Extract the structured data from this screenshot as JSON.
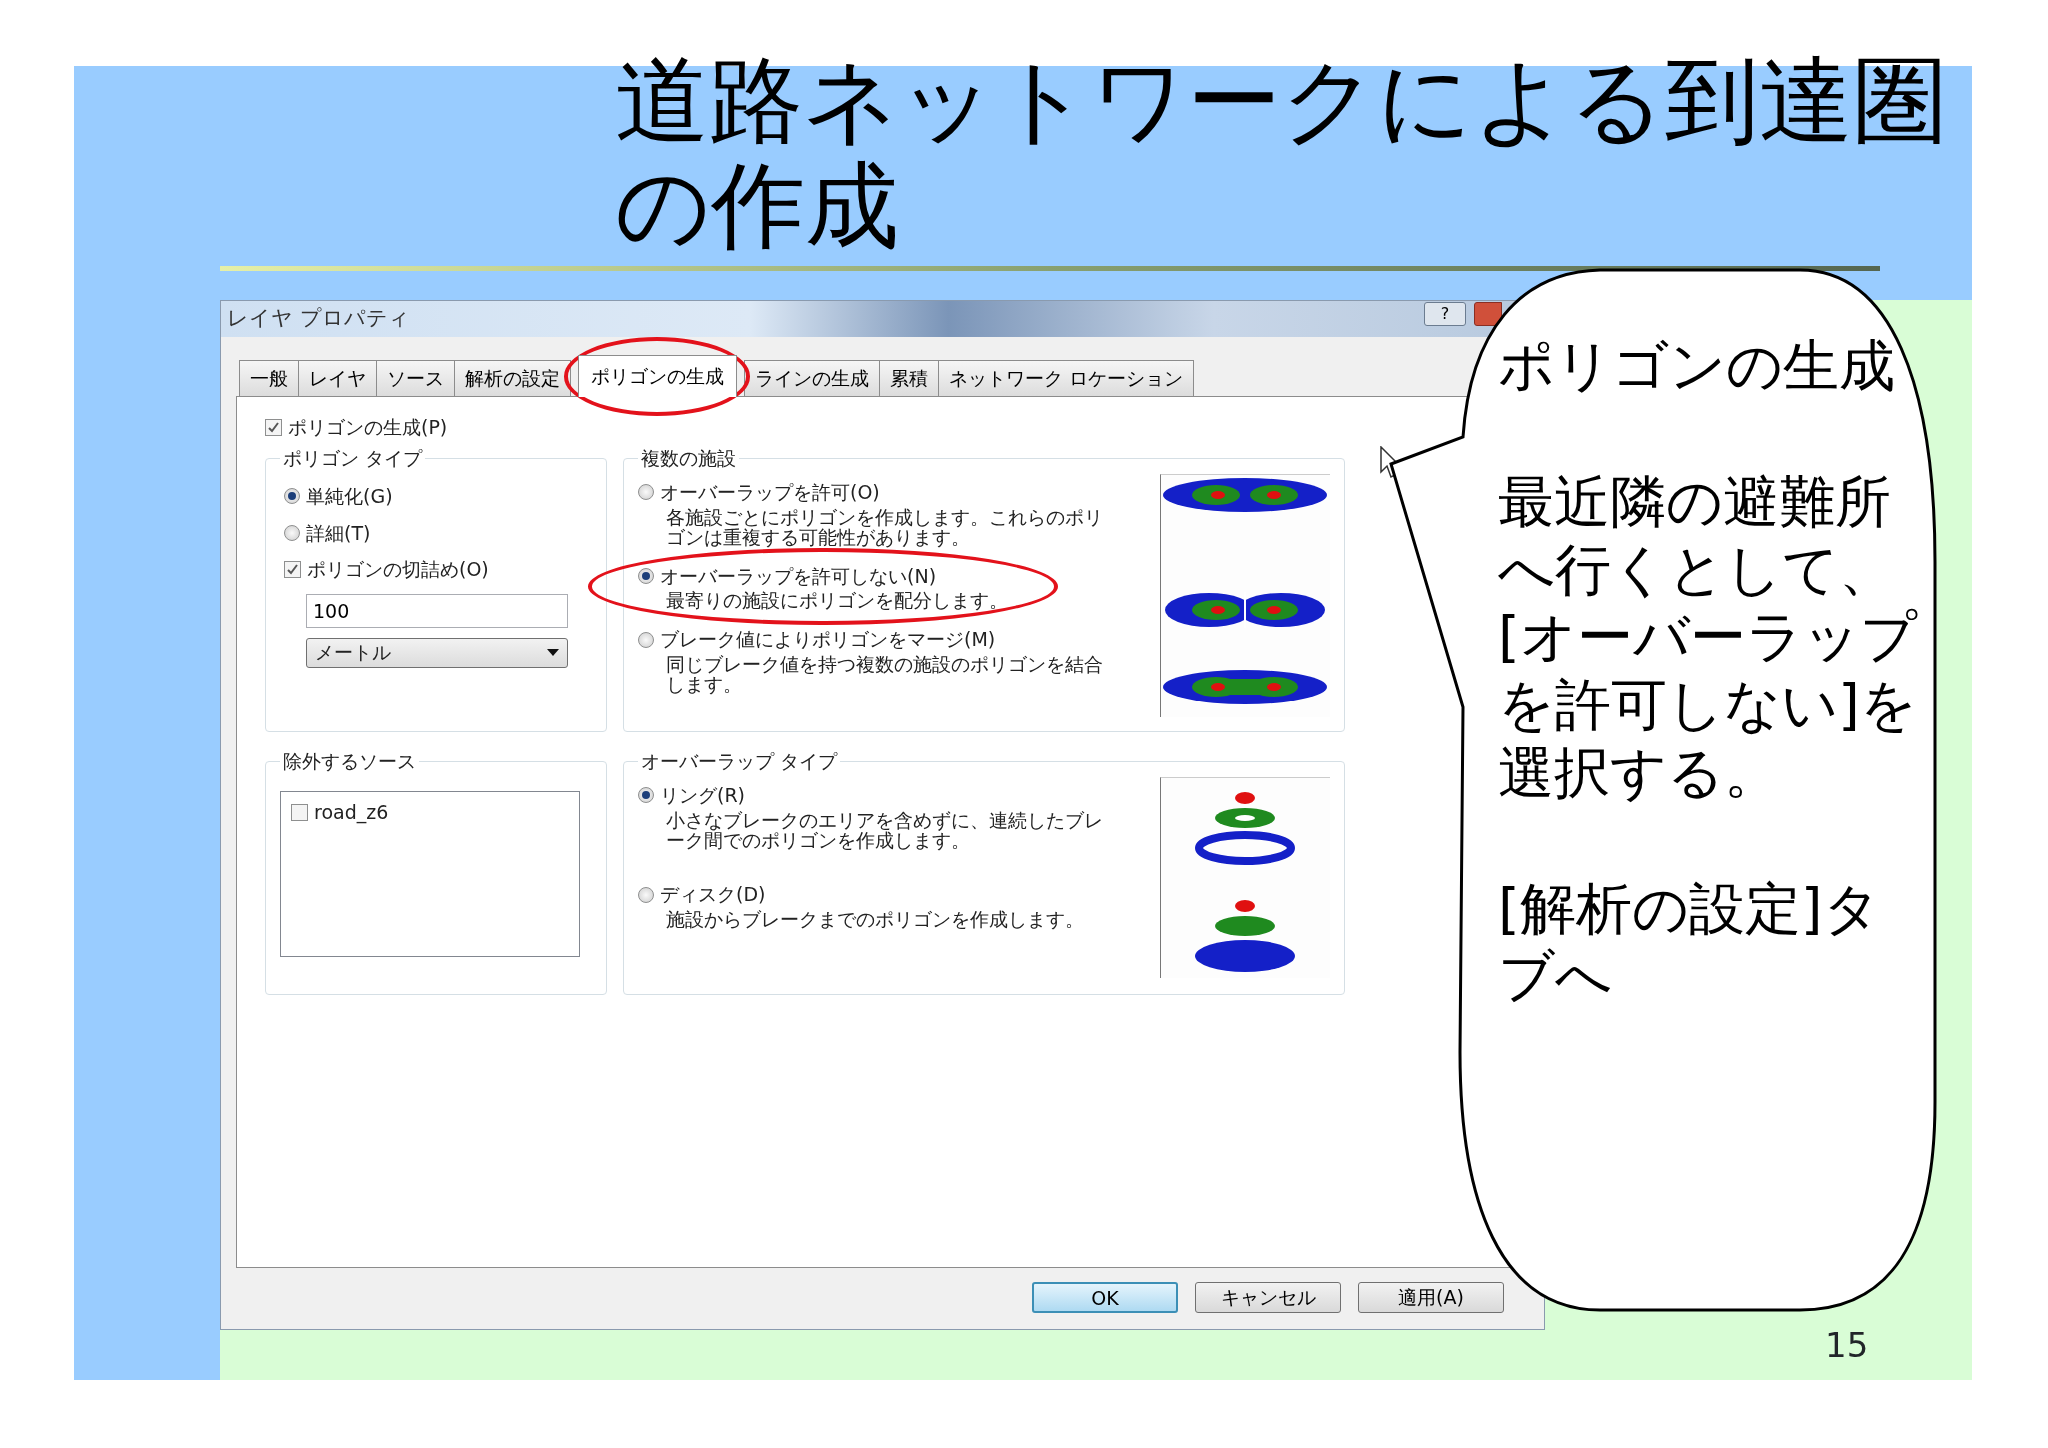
{
  "slide": {
    "title": "道路ネットワークによる到達圏の作成",
    "page_number": "15"
  },
  "dialog": {
    "title": "レイヤ プロパティ",
    "help_button": "?",
    "tabs": [
      {
        "label": "一般",
        "selected": false,
        "highlighted": false
      },
      {
        "label": "レイヤ",
        "selected": false,
        "highlighted": false
      },
      {
        "label": "ソース",
        "selected": false,
        "highlighted": false
      },
      {
        "label": "解析の設定",
        "selected": false,
        "highlighted": false
      },
      {
        "label": "ポリゴンの生成",
        "selected": true,
        "highlighted": true
      },
      {
        "label": "ラインの生成",
        "selected": false,
        "highlighted": false
      },
      {
        "label": "累積",
        "selected": false,
        "highlighted": false
      },
      {
        "label": "ネットワーク ロケーション",
        "selected": false,
        "highlighted": false
      }
    ],
    "generate_polygons": {
      "label": "ポリゴンの生成(P)",
      "checked": true
    },
    "polygon_type": {
      "title": "ポリゴン タイプ",
      "options": [
        {
          "label": "単純化(G)",
          "selected": true
        },
        {
          "label": "詳細(T)",
          "selected": false
        }
      ],
      "trim": {
        "label": "ポリゴンの切詰め(O)",
        "checked": true
      },
      "trim_distance": "100",
      "unit": "メートル"
    },
    "multiple_facilities": {
      "title": "複数の施設",
      "options": [
        {
          "label": "オーバーラップを許可(O)",
          "description": "各施設ごとにポリゴンを作成します。これらのポリゴンは重複する可能性があります。",
          "selected": false,
          "highlighted": false
        },
        {
          "label": "オーバーラップを許可しない(N)",
          "description": "最寄りの施設にポリゴンを配分します。",
          "selected": true,
          "highlighted": true
        },
        {
          "label": "ブレーク値によりポリゴンをマージ(M)",
          "description": "同じブレーク値を持つ複数の施設のポリゴンを結合します。",
          "selected": false,
          "highlighted": false
        }
      ]
    },
    "excluded_sources": {
      "title": "除外するソース",
      "items": [
        {
          "label": "road_z6",
          "checked": false
        }
      ]
    },
    "overlap_type": {
      "title": "オーバーラップ タイプ",
      "options": [
        {
          "label": "リング(R)",
          "description": "小さなブレークのエリアを含めずに、連続したブレーク間でのポリゴンを作成します。",
          "selected": true
        },
        {
          "label": "ディスク(D)",
          "description": "施設からブレークまでのポリゴンを作成します。",
          "selected": false
        }
      ]
    },
    "buttons": [
      {
        "label": "OK",
        "default": true
      },
      {
        "label": "キャンセル",
        "default": false
      },
      {
        "label": "適用(A)",
        "default": false
      }
    ]
  },
  "callout": {
    "paragraphs": [
      "ポリゴンの生成",
      "最近隣の避難所へ行くとして、[オーバーラップを許可しない]を選択する。",
      "[解析の設定]タブへ"
    ]
  }
}
